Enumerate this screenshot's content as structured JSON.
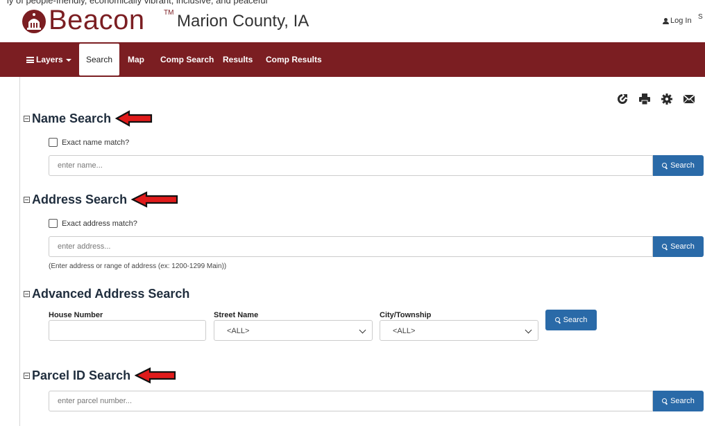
{
  "top_strip": "ly of people-friendly, economically vibrant, inclusive, and peaceful",
  "header": {
    "brand": "Beacon",
    "tm": "TM",
    "county": "Marion County, IA",
    "login": "Log In",
    "cut_link": "S"
  },
  "nav": {
    "layers": "Layers",
    "items": [
      "Search",
      "Map",
      "Comp Search",
      "Results",
      "Comp Results"
    ]
  },
  "toolbar_icons": [
    "share-icon",
    "print-icon",
    "gear-icon",
    "envelope-icon"
  ],
  "name_search": {
    "title": "Name Search",
    "checkbox_label": "Exact name match?",
    "placeholder": "enter name...",
    "button": "Search"
  },
  "address_search": {
    "title": "Address Search",
    "checkbox_label": "Exact address match?",
    "placeholder": "enter address...",
    "button": "Search",
    "hint": "(Enter address or range of address (ex: 1200-1299 Main))"
  },
  "advanced_search": {
    "title": "Advanced Address Search",
    "house_label": "House Number",
    "street_label": "Street Name",
    "street_value": "<ALL>",
    "city_label": "City/Township",
    "city_value": "<ALL>",
    "button": "Search"
  },
  "parcel_search": {
    "title": "Parcel ID Search",
    "placeholder": "enter parcel number...",
    "button": "Search"
  },
  "colors": {
    "brand": "#7b1e22",
    "button": "#2a6aa8",
    "arrow": "#e01b1b"
  }
}
